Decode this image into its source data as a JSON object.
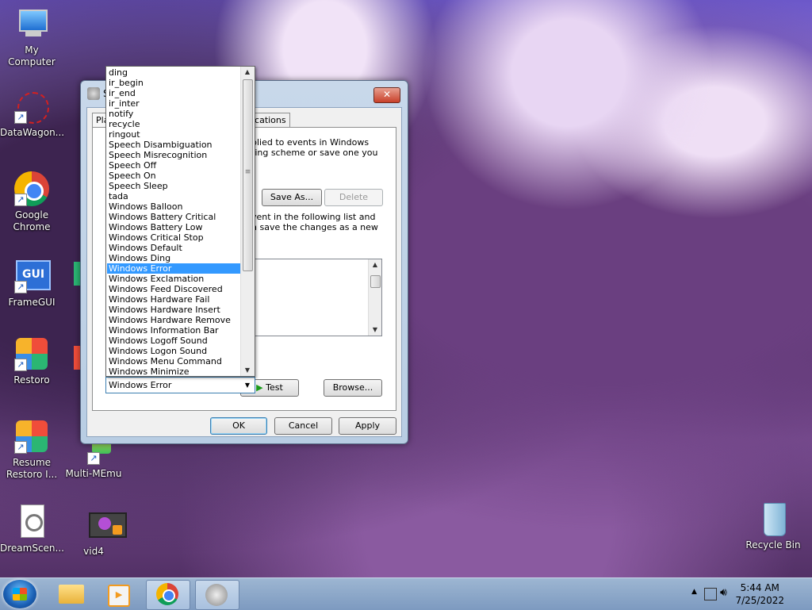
{
  "desktop": {
    "icons": [
      {
        "label": "My Computer"
      },
      {
        "label": "DataWagon..."
      },
      {
        "label": "Google Chrome"
      },
      {
        "label": "FrameGUI"
      },
      {
        "label": "Restoro"
      },
      {
        "label": "Resume Restoro I..."
      },
      {
        "label": "DreamScen..."
      },
      {
        "label": "Multi-MEmu"
      },
      {
        "label": "vid4"
      },
      {
        "label": "Recycle Bin"
      }
    ]
  },
  "dialog": {
    "title": "S",
    "close_label": "✕",
    "tabs": [
      "Pla",
      "nications"
    ],
    "description_lines": [
      "plied to events in Windows",
      "ting scheme or save one you"
    ],
    "instruction_lines": [
      "vent in the following list and",
      "n save the changes as a new"
    ],
    "save_as_label": "Save As...",
    "delete_label": "Delete",
    "test_label": "Test",
    "browse_label": "Browse...",
    "ok_label": "OK",
    "cancel_label": "Cancel",
    "apply_label": "Apply"
  },
  "sound_combo": {
    "selected": "Windows Error",
    "options": [
      "ding",
      "ir_begin",
      "ir_end",
      "ir_inter",
      "notify",
      "recycle",
      "ringout",
      "Speech Disambiguation",
      "Speech Misrecognition",
      "Speech Off",
      "Speech On",
      "Speech Sleep",
      "tada",
      "Windows Balloon",
      "Windows Battery Critical",
      "Windows Battery Low",
      "Windows Critical Stop",
      "Windows Default",
      "Windows Ding",
      "Windows Error",
      "Windows Exclamation",
      "Windows Feed Discovered",
      "Windows Hardware Fail",
      "Windows Hardware Insert",
      "Windows Hardware Remove",
      "Windows Information Bar",
      "Windows Logoff Sound",
      "Windows Logon Sound",
      "Windows Menu Command",
      "Windows Minimize"
    ]
  },
  "taskbar": {
    "time": "5:44 AM",
    "date": "7/25/2022"
  }
}
